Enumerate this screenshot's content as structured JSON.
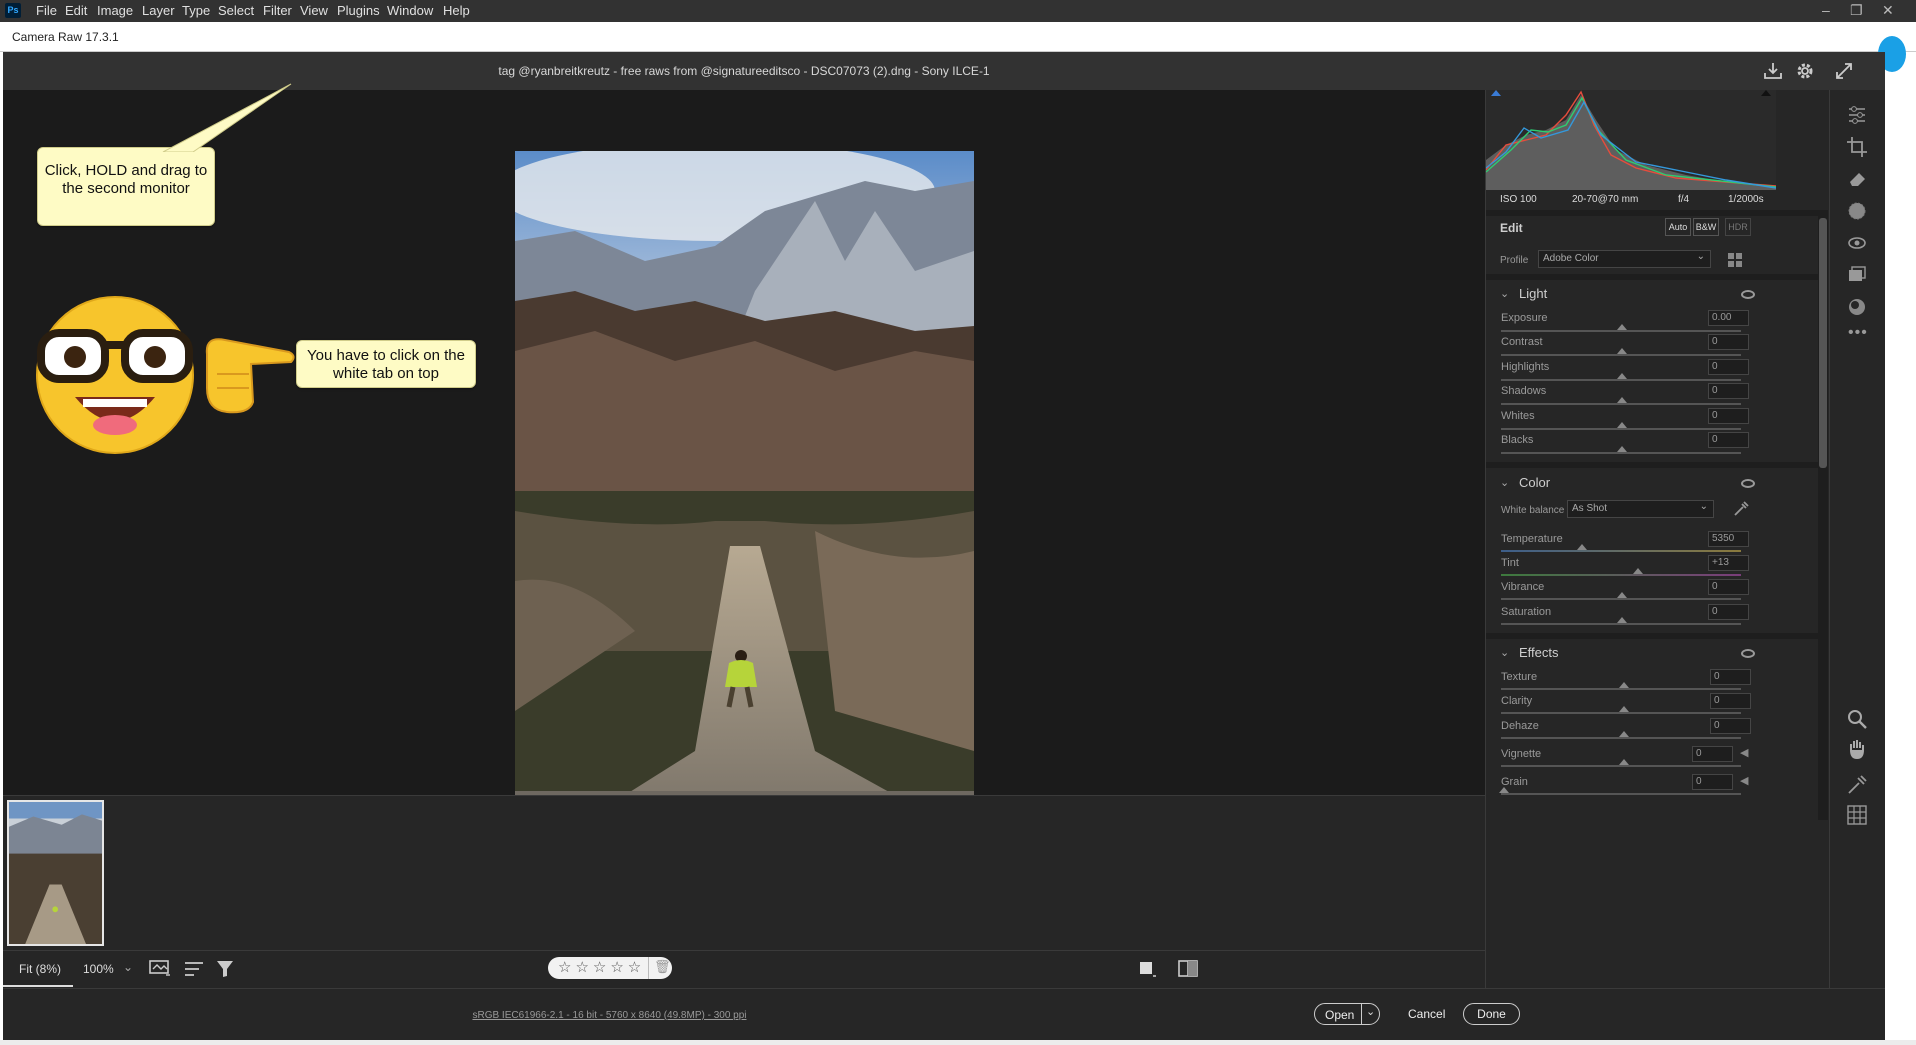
{
  "menubar": {
    "items": [
      "File",
      "Edit",
      "Image",
      "Layer",
      "Type",
      "Select",
      "Filter",
      "View",
      "Plugins",
      "Window",
      "Help"
    ],
    "ps_logo": "Ps",
    "window_controls": [
      "–",
      "❐",
      "✕"
    ]
  },
  "camera_raw_bar": {
    "title": "Camera Raw 17.3.1"
  },
  "titlebar": {
    "title": "tag @ryanbreitkreutz - free raws from @signatureeditsco - DSC07073 (2).dng  -  Sony ILCE-1"
  },
  "annotations": {
    "callout_drag": "Click, HOLD and drag to the second monitor",
    "callout_tab": "You have to click on the white tab on top"
  },
  "histogram": {
    "iso": "ISO 100",
    "lens": "20-70@70 mm",
    "aperture": "f/4",
    "shutter": "1/2000s"
  },
  "edit": {
    "title": "Edit",
    "auto": "Auto",
    "bw": "B&W",
    "hdr": "HDR",
    "profile_label": "Profile",
    "profile_value": "Adobe Color"
  },
  "light": {
    "title": "Light",
    "sliders": [
      {
        "label": "Exposure",
        "value": "0.00"
      },
      {
        "label": "Contrast",
        "value": "0"
      },
      {
        "label": "Highlights",
        "value": "0"
      },
      {
        "label": "Shadows",
        "value": "0"
      },
      {
        "label": "Whites",
        "value": "0"
      },
      {
        "label": "Blacks",
        "value": "0"
      }
    ]
  },
  "color": {
    "title": "Color",
    "wb_label": "White balance",
    "wb_value": "As Shot",
    "sliders": [
      {
        "label": "Temperature",
        "value": "5350"
      },
      {
        "label": "Tint",
        "value": "+13"
      },
      {
        "label": "Vibrance",
        "value": "0"
      },
      {
        "label": "Saturation",
        "value": "0"
      }
    ]
  },
  "effects": {
    "title": "Effects",
    "sliders": [
      {
        "label": "Texture",
        "value": "0"
      },
      {
        "label": "Clarity",
        "value": "0"
      },
      {
        "label": "Dehaze",
        "value": "0"
      },
      {
        "label": "Vignette",
        "value": "0"
      },
      {
        "label": "Grain",
        "value": "0"
      }
    ]
  },
  "bottombar": {
    "fit": "Fit (8%)",
    "zoom": "100%"
  },
  "footer": {
    "workflow": "sRGB IEC61966-2.1 - 16 bit - 5760 x 8640 (49.8MP) - 300 ppi",
    "open": "Open",
    "cancel": "Cancel",
    "done": "Done"
  },
  "colors": {
    "accent": "#31a8ff",
    "callout": "#fefbc5",
    "panel": "#262626"
  }
}
